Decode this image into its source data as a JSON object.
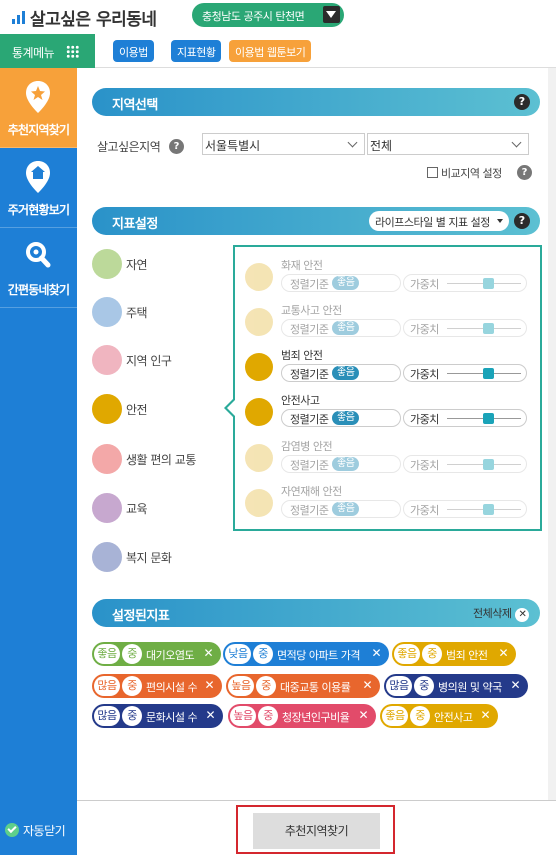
{
  "header": {
    "title": "살고싶은 우리동네",
    "location": "충청남도 공주시 탄천면"
  },
  "menubar": {
    "stats_menu": "통계메뉴",
    "buttons": [
      {
        "label": "이용법",
        "color": "#1e7fd6"
      },
      {
        "label": "지표현황",
        "color": "#1e7fd6"
      },
      {
        "label": "이용법 웹툰보기",
        "color": "#f7a13a"
      }
    ]
  },
  "sidebar": {
    "items": [
      {
        "label": "추천지역찾기",
        "active": true,
        "icon": "star-pin-icon"
      },
      {
        "label": "주거현황보기",
        "active": false,
        "icon": "house-pin-icon"
      },
      {
        "label": "간편동네찾기",
        "active": false,
        "icon": "magnifier-icon"
      }
    ],
    "auto_close": "자동닫기"
  },
  "region": {
    "section_title": "지역선택",
    "label": "살고싶은지역",
    "province": "서울특별시",
    "district": "전체",
    "compare_label": "비교지역 설정",
    "compare_checked": false
  },
  "indicator": {
    "section_title": "지표설정",
    "lifestyle_select": "라이프스타일 별 지표 설정",
    "categories": [
      {
        "label": "자연",
        "color": "#bcd99a",
        "icon": "leaf-icon"
      },
      {
        "label": "주택",
        "color": "#a9c7e6",
        "icon": "house-icon"
      },
      {
        "label": "지역 인구",
        "color": "#f0b5c0",
        "icon": "people-icon"
      },
      {
        "label": "안전",
        "color": "#e0a800",
        "icon": "safety-cone-icon"
      },
      {
        "label": "생활 편의 교통",
        "color": "#f3a8a8",
        "icon": "bus-icon"
      },
      {
        "label": "교육",
        "color": "#c7a8cf",
        "icon": "graduation-cap-icon"
      },
      {
        "label": "복지 문화",
        "color": "#a8b3d6",
        "icon": "heart-hand-icon"
      }
    ],
    "standard_label": "정렬기준",
    "good_label": "좋음",
    "weight_label": "가중치",
    "items": [
      {
        "name": "화재 안전",
        "active": false,
        "weight": 0.55
      },
      {
        "name": "교통사고 안전",
        "active": false,
        "weight": 0.55
      },
      {
        "name": "범죄 안전",
        "active": true,
        "weight": 0.55
      },
      {
        "name": "안전사고",
        "active": true,
        "weight": 0.55
      },
      {
        "name": "감염병 안전",
        "active": false,
        "weight": 0.55
      },
      {
        "name": "자연재해 안전",
        "active": false,
        "weight": 0.55
      }
    ]
  },
  "selected": {
    "section_title": "설정된지표",
    "clear_all": "전체삭제",
    "weight_mid": "중",
    "tags": [
      {
        "level": "좋음",
        "name": "대기오염도",
        "color": "#6fae45"
      },
      {
        "level": "낮음",
        "name": "면적당 아파트 가격",
        "color": "#1e7fd6"
      },
      {
        "level": "좋음",
        "name": "범죄 안전",
        "color": "#e0a800"
      },
      {
        "level": "많음",
        "name": "편의시설 수",
        "color": "#e8662d"
      },
      {
        "level": "높음",
        "name": "대중교통 이용률",
        "color": "#e8662d"
      },
      {
        "level": "많음",
        "name": "병의원 및 약국",
        "color": "#243a8a"
      },
      {
        "level": "많음",
        "name": "문화시설 수",
        "color": "#243a8a"
      },
      {
        "level": "높음",
        "name": "청장년인구비율",
        "color": "#e24b6a"
      },
      {
        "level": "좋음",
        "name": "안전사고",
        "color": "#e0a800"
      }
    ]
  },
  "footer": {
    "find_button": "추천지역찾기"
  }
}
